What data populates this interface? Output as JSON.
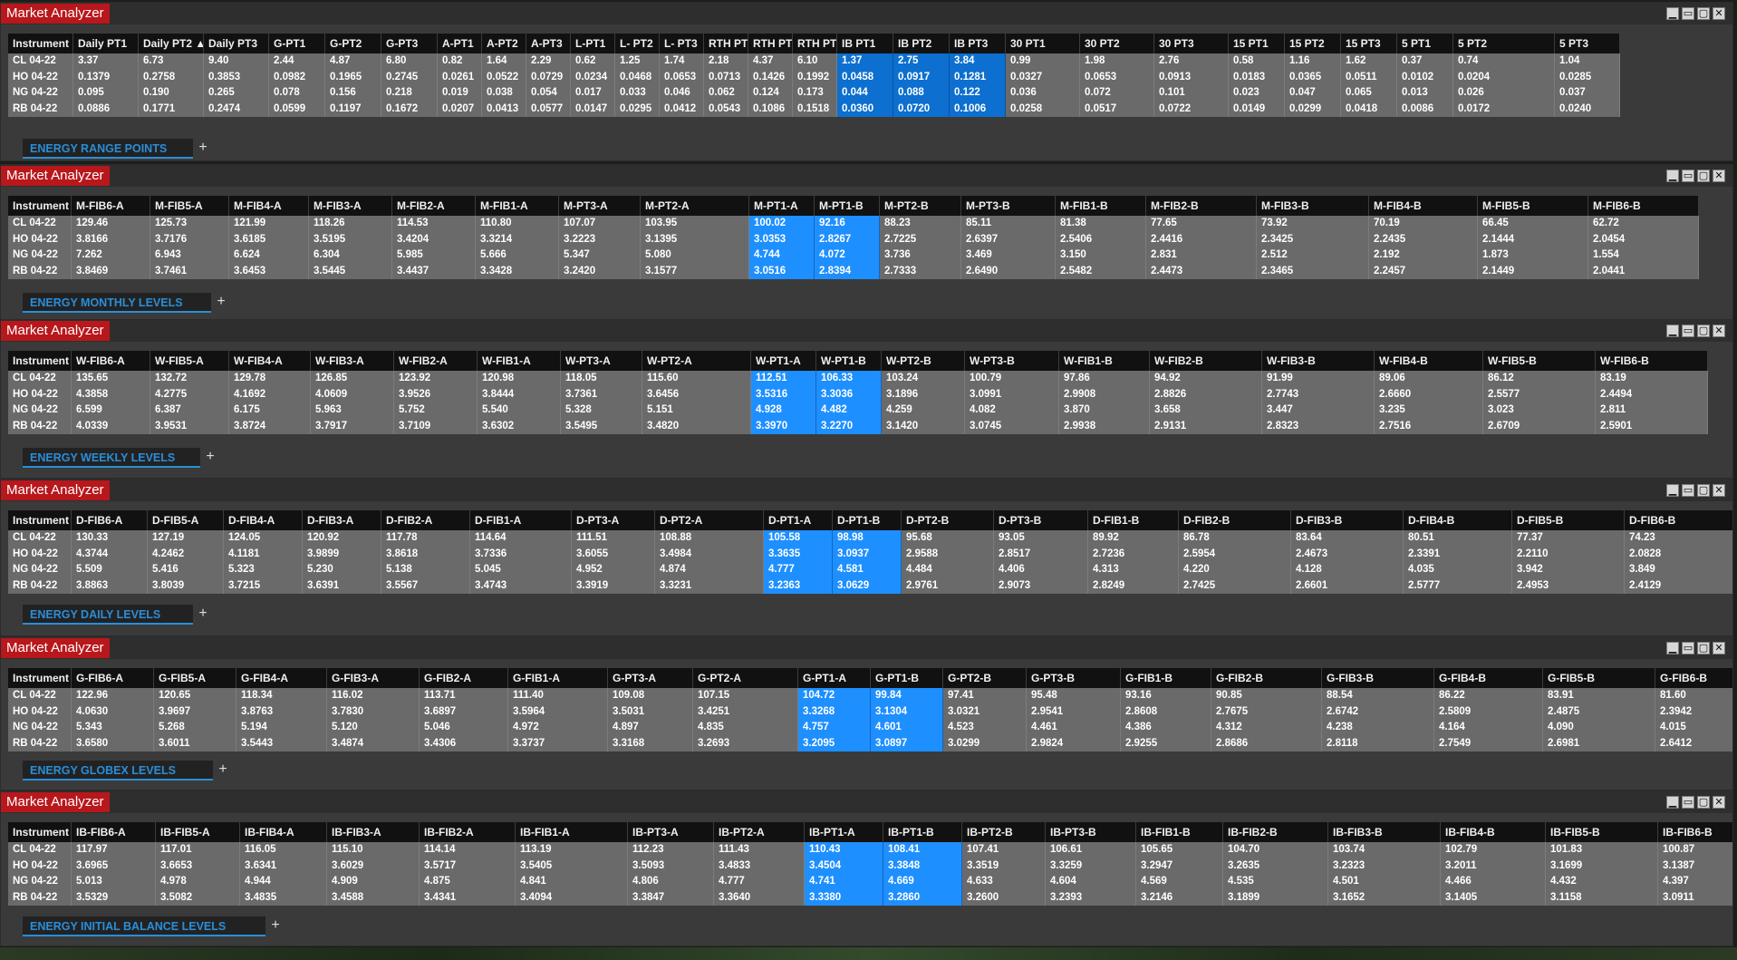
{
  "app_title": "Market Analyzer",
  "window_buttons": [
    "▁",
    "▭",
    "▢",
    "✕"
  ],
  "add_tab_label": "+",
  "windows": [
    {
      "tab": "ENERGY RANGE POINTS",
      "headers": [
        "Instrument",
        "Daily PT1",
        "Daily PT2 ▲",
        "Daily PT3",
        "G-PT1",
        "G-PT2",
        "G-PT3",
        "A-PT1",
        "A-PT2",
        "A-PT3",
        "L-PT1",
        "L- PT2",
        "L- PT3",
        "RTH PT1",
        "RTH PT2",
        "RTH PT3",
        "IB PT1",
        "IB PT2",
        "IB PT3",
        "30 PT1",
        "30 PT2",
        "30 PT3",
        "15 PT1",
        "15 PT2",
        "15 PT3",
        "5 PT1",
        "5 PT2",
        "5 PT3"
      ],
      "rows": [
        [
          "CL 04-22",
          "3.37",
          "6.73",
          "9.40",
          "2.44",
          "4.87",
          "6.80",
          "0.82",
          "1.64",
          "2.29",
          "0.62",
          "1.25",
          "1.74",
          "2.18",
          "4.37",
          "6.10",
          "1.37",
          "2.75",
          "3.84",
          "0.99",
          "1.98",
          "2.76",
          "0.58",
          "1.16",
          "1.62",
          "0.37",
          "0.74",
          "1.04"
        ],
        [
          "HO 04-22",
          "0.1379",
          "0.2758",
          "0.3853",
          "0.0982",
          "0.1965",
          "0.2745",
          "0.0261",
          "0.0522",
          "0.0729",
          "0.0234",
          "0.0468",
          "0.0653",
          "0.0713",
          "0.1426",
          "0.1992",
          "0.0458",
          "0.0917",
          "0.1281",
          "0.0327",
          "0.0653",
          "0.0913",
          "0.0183",
          "0.0365",
          "0.0511",
          "0.0102",
          "0.0204",
          "0.0285"
        ],
        [
          "NG 04-22",
          "0.095",
          "0.190",
          "0.265",
          "0.078",
          "0.156",
          "0.218",
          "0.019",
          "0.038",
          "0.054",
          "0.017",
          "0.033",
          "0.046",
          "0.062",
          "0.124",
          "0.173",
          "0.044",
          "0.088",
          "0.122",
          "0.036",
          "0.072",
          "0.101",
          "0.023",
          "0.047",
          "0.065",
          "0.013",
          "0.026",
          "0.037"
        ],
        [
          "RB 04-22",
          "0.0886",
          "0.1771",
          "0.2474",
          "0.0599",
          "0.1197",
          "0.1672",
          "0.0207",
          "0.0413",
          "0.0577",
          "0.0147",
          "0.0295",
          "0.0412",
          "0.0543",
          "0.1086",
          "0.1518",
          "0.0360",
          "0.0720",
          "0.1006",
          "0.0258",
          "0.0517",
          "0.0722",
          "0.0149",
          "0.0299",
          "0.0418",
          "0.0086",
          "0.0172",
          "0.0240"
        ]
      ]
    },
    {
      "tab": "ENERGY MONTHLY LEVELS",
      "headers": [
        "Instrument",
        "M-FIB6-A",
        "M-FIB5-A",
        "M-FIB4-A",
        "M-FIB3-A",
        "M-FIB2-A",
        "M-FIB1-A",
        "M-PT3-A",
        "M-PT2-A",
        "M-PT1-A",
        "M-PT1-B",
        "M-PT2-B",
        "M-PT3-B",
        "M-FIB1-B",
        "M-FIB2-B",
        "M-FIB3-B",
        "M-FIB4-B",
        "M-FIB5-B",
        "M-FIB6-B"
      ],
      "rows": [
        [
          "CL 04-22",
          "129.46",
          "125.73",
          "121.99",
          "118.26",
          "114.53",
          "110.80",
          "107.07",
          "103.95",
          "100.02",
          "92.16",
          "88.23",
          "85.11",
          "81.38",
          "77.65",
          "73.92",
          "70.19",
          "66.45",
          "62.72"
        ],
        [
          "HO 04-22",
          "3.8166",
          "3.7176",
          "3.6185",
          "3.5195",
          "3.4204",
          "3.3214",
          "3.2223",
          "3.1395",
          "3.0353",
          "2.8267",
          "2.7225",
          "2.6397",
          "2.5406",
          "2.4416",
          "2.3425",
          "2.2435",
          "2.1444",
          "2.0454"
        ],
        [
          "NG 04-22",
          "7.262",
          "6.943",
          "6.624",
          "6.304",
          "5.985",
          "5.666",
          "5.347",
          "5.080",
          "4.744",
          "4.072",
          "3.736",
          "3.469",
          "3.150",
          "2.831",
          "2.512",
          "2.192",
          "1.873",
          "1.554"
        ],
        [
          "RB 04-22",
          "3.8469",
          "3.7461",
          "3.6453",
          "3.5445",
          "3.4437",
          "3.3428",
          "3.2420",
          "3.1577",
          "3.0516",
          "2.8394",
          "2.7333",
          "2.6490",
          "2.5482",
          "2.4473",
          "2.3465",
          "2.2457",
          "2.1449",
          "2.0441"
        ]
      ]
    },
    {
      "tab": "ENERGY WEEKLY LEVELS",
      "headers": [
        "Instrument",
        "W-FIB6-A",
        "W-FIB5-A",
        "W-FIB4-A",
        "W-FIB3-A",
        "W-FIB2-A",
        "W-FIB1-A",
        "W-PT3-A",
        "W-PT2-A",
        "W-PT1-A",
        "W-PT1-B",
        "W-PT2-B",
        "W-PT3-B",
        "W-FIB1-B",
        "W-FIB2-B",
        "W-FIB3-B",
        "W-FIB4-B",
        "W-FIB5-B",
        "W-FIB6-B"
      ],
      "rows": [
        [
          "CL 04-22",
          "135.65",
          "132.72",
          "129.78",
          "126.85",
          "123.92",
          "120.98",
          "118.05",
          "115.60",
          "112.51",
          "106.33",
          "103.24",
          "100.79",
          "97.86",
          "94.92",
          "91.99",
          "89.06",
          "86.12",
          "83.19"
        ],
        [
          "HO 04-22",
          "4.3858",
          "4.2775",
          "4.1692",
          "4.0609",
          "3.9526",
          "3.8444",
          "3.7361",
          "3.6456",
          "3.5316",
          "3.3036",
          "3.1896",
          "3.0991",
          "2.9908",
          "2.8826",
          "2.7743",
          "2.6660",
          "2.5577",
          "2.4494"
        ],
        [
          "NG 04-22",
          "6.599",
          "6.387",
          "6.175",
          "5.963",
          "5.752",
          "5.540",
          "5.328",
          "5.151",
          "4.928",
          "4.482",
          "4.259",
          "4.082",
          "3.870",
          "3.658",
          "3.447",
          "3.235",
          "3.023",
          "2.811"
        ],
        [
          "RB 04-22",
          "4.0339",
          "3.9531",
          "3.8724",
          "3.7917",
          "3.7109",
          "3.6302",
          "3.5495",
          "3.4820",
          "3.3970",
          "3.2270",
          "3.1420",
          "3.0745",
          "2.9938",
          "2.9131",
          "2.8323",
          "2.7516",
          "2.6709",
          "2.5901"
        ]
      ]
    },
    {
      "tab": "ENERGY DAILY LEVELS",
      "headers": [
        "Instrument",
        "D-FIB6-A",
        "D-FIB5-A",
        "D-FIB4-A",
        "D-FIB3-A",
        "D-FIB2-A",
        "D-FIB1-A",
        "D-PT3-A",
        "D-PT2-A",
        "D-PT1-A",
        "D-PT1-B",
        "D-PT2-B",
        "D-PT3-B",
        "D-FIB1-B",
        "D-FIB2-B",
        "D-FIB3-B",
        "D-FIB4-B",
        "D-FIB5-B",
        "D-FIB6-B"
      ],
      "rows": [
        [
          "CL 04-22",
          "130.33",
          "127.19",
          "124.05",
          "120.92",
          "117.78",
          "114.64",
          "111.51",
          "108.88",
          "105.58",
          "98.98",
          "95.68",
          "93.05",
          "89.92",
          "86.78",
          "83.64",
          "80.51",
          "77.37",
          "74.23"
        ],
        [
          "HO 04-22",
          "4.3744",
          "4.2462",
          "4.1181",
          "3.9899",
          "3.8618",
          "3.7336",
          "3.6055",
          "3.4984",
          "3.3635",
          "3.0937",
          "2.9588",
          "2.8517",
          "2.7236",
          "2.5954",
          "2.4673",
          "2.3391",
          "2.2110",
          "2.0828"
        ],
        [
          "NG 04-22",
          "5.509",
          "5.416",
          "5.323",
          "5.230",
          "5.138",
          "5.045",
          "4.952",
          "4.874",
          "4.777",
          "4.581",
          "4.484",
          "4.406",
          "4.313",
          "4.220",
          "4.128",
          "4.035",
          "3.942",
          "3.849"
        ],
        [
          "RB 04-22",
          "3.8863",
          "3.8039",
          "3.7215",
          "3.6391",
          "3.5567",
          "3.4743",
          "3.3919",
          "3.3231",
          "3.2363",
          "3.0629",
          "2.9761",
          "2.9073",
          "2.8249",
          "2.7425",
          "2.6601",
          "2.5777",
          "2.4953",
          "2.4129"
        ]
      ]
    },
    {
      "tab": "ENERGY GLOBEX LEVELS",
      "headers": [
        "Instrument",
        "G-FIB6-A",
        "G-FIB5-A",
        "G-FIB4-A",
        "G-FIB3-A",
        "G-FIB2-A",
        "G-FIB1-A",
        "G-PT3-A",
        "G-PT2-A",
        "G-PT1-A",
        "G-PT1-B",
        "G-PT2-B",
        "G-PT3-B",
        "G-FIB1-B",
        "G-FIB2-B",
        "G-FIB3-B",
        "G-FIB4-B",
        "G-FIB5-B",
        "G-FIB6-B"
      ],
      "rows": [
        [
          "CL 04-22",
          "122.96",
          "120.65",
          "118.34",
          "116.02",
          "113.71",
          "111.40",
          "109.08",
          "107.15",
          "104.72",
          "99.84",
          "97.41",
          "95.48",
          "93.16",
          "90.85",
          "88.54",
          "86.22",
          "83.91",
          "81.60"
        ],
        [
          "HO 04-22",
          "4.0630",
          "3.9697",
          "3.8763",
          "3.7830",
          "3.6897",
          "3.5964",
          "3.5031",
          "3.4251",
          "3.3268",
          "3.1304",
          "3.0321",
          "2.9541",
          "2.8608",
          "2.7675",
          "2.6742",
          "2.5809",
          "2.4875",
          "2.3942"
        ],
        [
          "NG 04-22",
          "5.343",
          "5.268",
          "5.194",
          "5.120",
          "5.046",
          "4.972",
          "4.897",
          "4.835",
          "4.757",
          "4.601",
          "4.523",
          "4.461",
          "4.386",
          "4.312",
          "4.238",
          "4.164",
          "4.090",
          "4.015"
        ],
        [
          "RB 04-22",
          "3.6580",
          "3.6011",
          "3.5443",
          "3.4874",
          "3.4306",
          "3.3737",
          "3.3168",
          "3.2693",
          "3.2095",
          "3.0897",
          "3.0299",
          "2.9824",
          "2.9255",
          "2.8686",
          "2.8118",
          "2.7549",
          "2.6981",
          "2.6412"
        ]
      ]
    },
    {
      "tab": "ENERGY INITIAL BALANCE LEVELS",
      "headers": [
        "Instrument",
        "IB-FIB6-A",
        "IB-FIB5-A",
        "IB-FIB4-A",
        "IB-FIB3-A",
        "IB-FIB2-A",
        "IB-FIB1-A",
        "IB-PT3-A",
        "IB-PT2-A",
        "IB-PT1-A",
        "IB-PT1-B",
        "IB-PT2-B",
        "IB-PT3-B",
        "IB-FIB1-B",
        "IB-FIB2-B",
        "IB-FIB3-B",
        "IB-FIB4-B",
        "IB-FIB5-B",
        "IB-FIB6-B"
      ],
      "rows": [
        [
          "CL 04-22",
          "117.97",
          "117.01",
          "116.05",
          "115.10",
          "114.14",
          "113.19",
          "112.23",
          "111.43",
          "110.43",
          "108.41",
          "107.41",
          "106.61",
          "105.65",
          "104.70",
          "103.74",
          "102.79",
          "101.83",
          "100.87"
        ],
        [
          "HO 04-22",
          "3.6965",
          "3.6653",
          "3.6341",
          "3.6029",
          "3.5717",
          "3.5405",
          "3.5093",
          "3.4833",
          "3.4504",
          "3.3848",
          "3.3519",
          "3.3259",
          "3.2947",
          "3.2635",
          "3.2323",
          "3.2011",
          "3.1699",
          "3.1387"
        ],
        [
          "NG 04-22",
          "5.013",
          "4.978",
          "4.944",
          "4.909",
          "4.875",
          "4.841",
          "4.806",
          "4.777",
          "4.741",
          "4.669",
          "4.633",
          "4.604",
          "4.569",
          "4.535",
          "4.501",
          "4.466",
          "4.432",
          "4.397"
        ],
        [
          "RB 04-22",
          "3.5329",
          "3.5082",
          "3.4835",
          "3.4588",
          "3.4341",
          "3.4094",
          "3.3847",
          "3.3640",
          "3.3380",
          "3.2860",
          "3.2600",
          "3.2393",
          "3.2146",
          "3.1899",
          "3.1652",
          "3.1405",
          "3.1158",
          "3.0911"
        ]
      ]
    }
  ]
}
